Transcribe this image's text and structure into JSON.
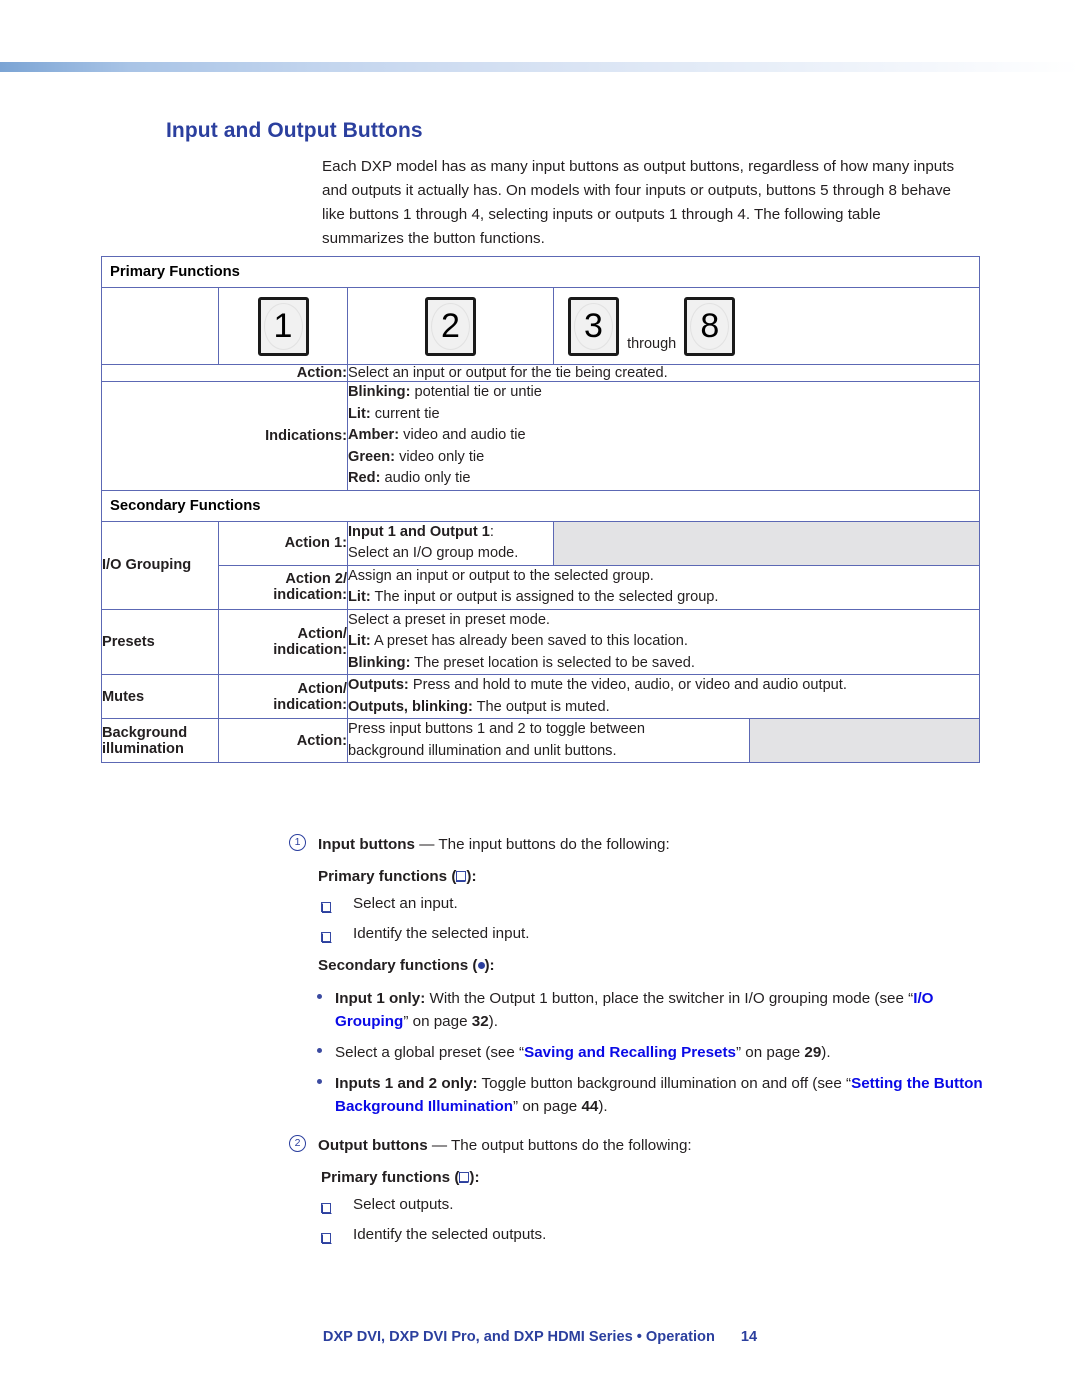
{
  "heading": "Input and Output Buttons",
  "intro": "Each DXP model has as many input buttons as output buttons, regardless of how many inputs and outputs it actually has. On models with four inputs or outputs, buttons 5 through 8 behave like buttons 1 through 4, selecting inputs or outputs 1 through 4. The following table summarizes the button functions.",
  "table": {
    "primary_band": "Primary Functions",
    "secondary_band": "Secondary Functions",
    "buttons": {
      "btn1": "1",
      "btn2": "2",
      "btn3": "3",
      "btn8": "8",
      "through": "through"
    },
    "action_label": "Action:",
    "action_text": "Select an input or output for the tie being created.",
    "indications_label": "Indications:",
    "indications": [
      {
        "key": "Blinking:",
        "text": " potential tie or untie"
      },
      {
        "key": "Lit:",
        "text": " current tie"
      },
      {
        "key": "Amber:",
        "text": " video and audio tie"
      },
      {
        "key": "Green:",
        "text": " video only tie"
      },
      {
        "key": "Red:",
        "text": " audio only tie"
      }
    ],
    "io_grouping": {
      "row_label": "I/O Grouping",
      "action1_label": "Action 1:",
      "action1_bold": "Input 1 and Output 1",
      "action1_tail": ":",
      "action1_text": "Select an I/O group mode.",
      "action2_label_line1": "Action 2/",
      "action2_label_line2": "indication:",
      "action2_line1": "Assign an input or output to the selected group.",
      "action2_line2_key": "Lit:",
      "action2_line2_text": " The input or output is assigned to the selected group."
    },
    "presets": {
      "row_label": "Presets",
      "label_line1": "Action/",
      "label_line2": "indication:",
      "line1": "Select a preset in preset mode.",
      "line2_key": "Lit:",
      "line2_text": " A preset has already been saved to this location.",
      "line3_key": "Blinking:",
      "line3_text": " The preset location is selected to be saved."
    },
    "mutes": {
      "row_label": "Mutes",
      "label_line1": "Action/",
      "label_line2": "indication:",
      "line1_key": "Outputs:",
      "line1_text": " Press and hold to mute the video, audio, or video and audio output.",
      "line2_key": "Outputs, blinking:",
      "line2_text": " The output is muted."
    },
    "background_illumination": {
      "row_label_line1": "Background",
      "row_label_line2": "illumination",
      "label": "Action:",
      "line1": "Press input buttons 1 and 2 to toggle between",
      "line2": "background illumination and unlit buttons."
    }
  },
  "notes": {
    "item1": {
      "number": "1",
      "bold": "Input buttons",
      "dash": " — ",
      "tail": "The input buttons do the following:",
      "primary_head_pre": "Primary functions (",
      "primary_head_post": "):",
      "primary_items": [
        "Select an input.",
        "Identify the selected input."
      ],
      "secondary_head_pre": "Secondary functions (",
      "secondary_head_post": "):",
      "secondary_items": [
        {
          "bold": "Input 1 only:",
          "text1": " With the Output 1 button, place the switcher in I/O grouping mode (see “",
          "link": "I/O Grouping",
          "text2": "” on page ",
          "page": "32",
          "text3": ")."
        },
        {
          "bold": "",
          "text1": "Select a global preset (see “",
          "link": "Saving and Recalling Presets",
          "text2": "” on page ",
          "page": "29",
          "text3": ")."
        },
        {
          "bold": "Inputs 1 and 2 only:",
          "text1": " Toggle button background illumination on and off (see “",
          "link": "Setting the Button Background Illumination",
          "text2": "” on page ",
          "page": "44",
          "text3": ")."
        }
      ]
    },
    "item2": {
      "number": "2",
      "bold": "Output buttons",
      "dash": " — ",
      "tail": "The output buttons do the following:",
      "primary_head_pre": "Primary functions (",
      "primary_head_post": "):",
      "primary_items": [
        "Select outputs.",
        "Identify the selected outputs."
      ]
    }
  },
  "footer": {
    "text": "DXP DVI, DXP DVI Pro, and DXP HDMI Series • Operation",
    "page_number": "14"
  }
}
